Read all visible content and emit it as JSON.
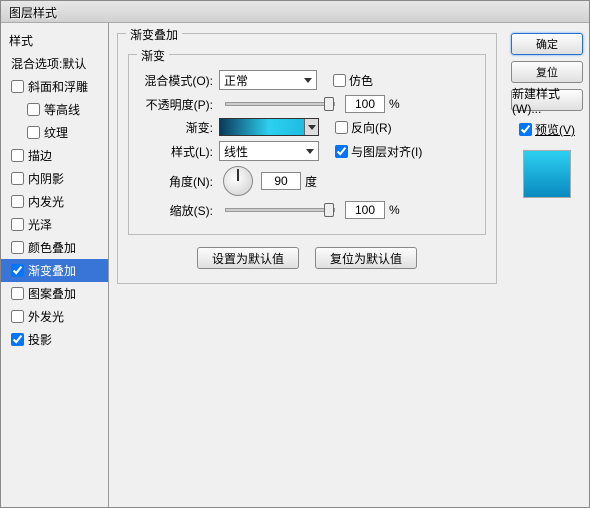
{
  "window_title": "图层样式",
  "left": {
    "section": "样式",
    "blend_default": "混合选项:默认",
    "items": [
      {
        "label": "斜面和浮雕",
        "checked": false,
        "indent": false
      },
      {
        "label": "等高线",
        "checked": false,
        "indent": true
      },
      {
        "label": "纹理",
        "checked": false,
        "indent": true
      },
      {
        "label": "描边",
        "checked": false,
        "indent": false
      },
      {
        "label": "内阴影",
        "checked": false,
        "indent": false
      },
      {
        "label": "内发光",
        "checked": false,
        "indent": false
      },
      {
        "label": "光泽",
        "checked": false,
        "indent": false
      },
      {
        "label": "颜色叠加",
        "checked": false,
        "indent": false
      },
      {
        "label": "渐变叠加",
        "checked": true,
        "indent": false,
        "selected": true
      },
      {
        "label": "图案叠加",
        "checked": false,
        "indent": false
      },
      {
        "label": "外发光",
        "checked": false,
        "indent": false
      },
      {
        "label": "投影",
        "checked": true,
        "indent": false
      }
    ]
  },
  "main": {
    "group_title": "渐变叠加",
    "subgroup": "渐变",
    "blend_mode_label": "混合模式(O):",
    "blend_mode_value": "正常",
    "dither_label": "仿色",
    "opacity_label": "不透明度(P):",
    "opacity_value": "100",
    "opacity_unit": "%",
    "gradient_label": "渐变:",
    "reverse_label": "反向(R)",
    "style_label": "样式(L):",
    "style_value": "线性",
    "align_label": "与图层对齐(I)",
    "angle_label": "角度(N):",
    "angle_value": "90",
    "angle_unit": "度",
    "scale_label": "缩放(S):",
    "scale_value": "100",
    "scale_unit": "%",
    "btn_default": "设置为默认值",
    "btn_reset": "复位为默认值"
  },
  "right": {
    "ok": "确定",
    "reset": "复位",
    "new_style": "新建样式(W)...",
    "preview_label": "预览(V)",
    "preview_checked": true
  }
}
